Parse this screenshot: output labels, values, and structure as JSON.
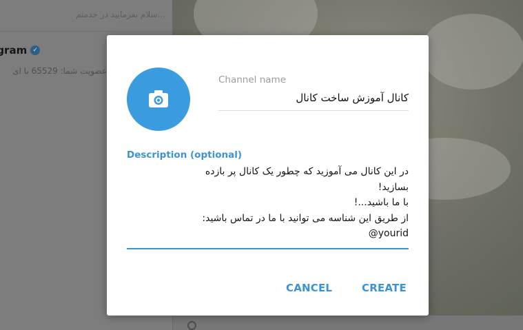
{
  "background": {
    "preview_top": "...سلام بفرمایید در خدمتم",
    "chat_title": "legram",
    "chat_preview": "عضویت شما: 65529 با ای"
  },
  "dialog": {
    "channel_name_label": "Channel name",
    "channel_name_value": "کانال آموزش ساخت کانال",
    "description_label": "Description (optional)",
    "description_lines": [
      "در این کانال می آموزید که چطور یک کانال پر بازده",
      "بسازید!",
      "با ما باشید...!",
      "از طریق این شناسه می توانید با ما در تماس باشید:",
      "yourid@"
    ],
    "cancel_label": "CANCEL",
    "create_label": "CREATE"
  },
  "icons": {
    "photo": "camera-icon",
    "verified": "verified-badge-icon",
    "search": "search-icon"
  },
  "colors": {
    "accent": "#3a93d6",
    "avatar": "#3a9bde"
  }
}
